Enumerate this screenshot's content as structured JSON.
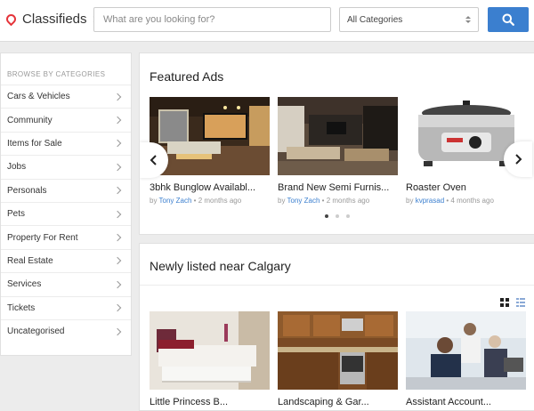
{
  "header": {
    "brand": "Classifieds",
    "search_placeholder": "What are you looking for?",
    "category_selected": "All Categories"
  },
  "sidebar": {
    "title": "BROWSE BY CATEGORIES",
    "items": [
      "Cars & Vehicles",
      "Community",
      "Items for Sale",
      "Jobs",
      "Personals",
      "Pets",
      "Property For Rent",
      "Real Estate",
      "Services",
      "Tickets",
      "Uncategorised"
    ]
  },
  "featured": {
    "title": "Featured Ads",
    "ads": [
      {
        "title": "3bhk Bunglow Availabl...",
        "by": "by",
        "author": "Tony Zach",
        "time": "2 months ago"
      },
      {
        "title": "Brand New Semi Furnis...",
        "by": "by",
        "author": "Tony Zach",
        "time": "2 months ago"
      },
      {
        "title": "Roaster Oven",
        "by": "by",
        "author": "kvprasad",
        "time": "4 months ago"
      }
    ]
  },
  "newly": {
    "title": "Newly listed near Calgary",
    "ads": [
      {
        "title": "Little Princess B..."
      },
      {
        "title": "Landscaping & Gar..."
      },
      {
        "title": "Assistant Account..."
      }
    ]
  },
  "colors": {
    "accent": "#3b7fcf",
    "brand_pin": "#e5343a"
  }
}
